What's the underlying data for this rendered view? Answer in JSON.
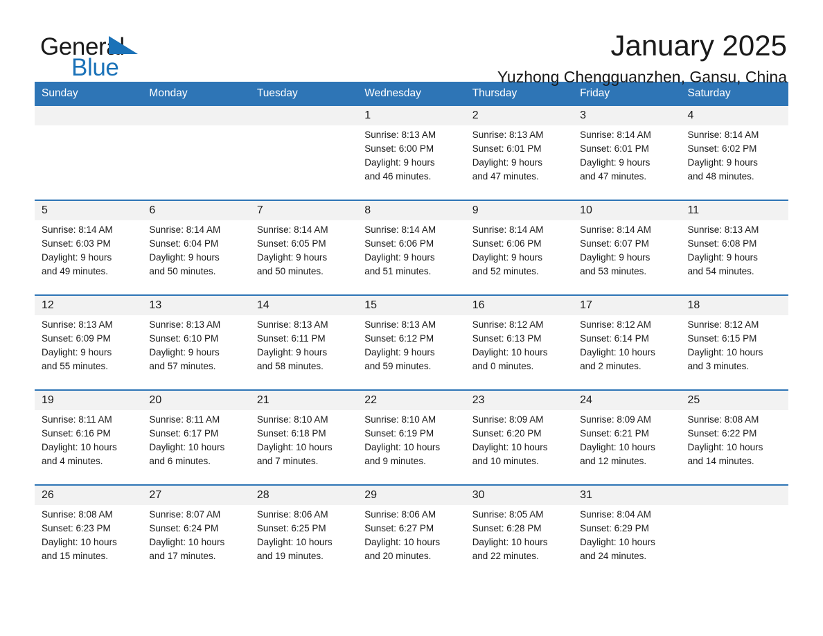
{
  "logo": {
    "word_one": "General",
    "word_two": "Blue",
    "triangle_color": "#1B72B8"
  },
  "header": {
    "month_title": "January 2025",
    "location": "Yuzhong Chengguanzhen, Gansu, China"
  },
  "theme": {
    "header_blue": "#2E75B6",
    "daynum_background": "#f2f2f2",
    "text": "#1a1a1a"
  },
  "calendar": {
    "weekday_headers": [
      "Sunday",
      "Monday",
      "Tuesday",
      "Wednesday",
      "Thursday",
      "Friday",
      "Saturday"
    ],
    "weeks": [
      [
        {
          "day": "",
          "sunrise": "",
          "sunset": "",
          "daylight_1": "",
          "daylight_2": ""
        },
        {
          "day": "",
          "sunrise": "",
          "sunset": "",
          "daylight_1": "",
          "daylight_2": ""
        },
        {
          "day": "",
          "sunrise": "",
          "sunset": "",
          "daylight_1": "",
          "daylight_2": ""
        },
        {
          "day": "1",
          "sunrise": "Sunrise: 8:13 AM",
          "sunset": "Sunset: 6:00 PM",
          "daylight_1": "Daylight: 9 hours",
          "daylight_2": "and 46 minutes."
        },
        {
          "day": "2",
          "sunrise": "Sunrise: 8:13 AM",
          "sunset": "Sunset: 6:01 PM",
          "daylight_1": "Daylight: 9 hours",
          "daylight_2": "and 47 minutes."
        },
        {
          "day": "3",
          "sunrise": "Sunrise: 8:14 AM",
          "sunset": "Sunset: 6:01 PM",
          "daylight_1": "Daylight: 9 hours",
          "daylight_2": "and 47 minutes."
        },
        {
          "day": "4",
          "sunrise": "Sunrise: 8:14 AM",
          "sunset": "Sunset: 6:02 PM",
          "daylight_1": "Daylight: 9 hours",
          "daylight_2": "and 48 minutes."
        }
      ],
      [
        {
          "day": "5",
          "sunrise": "Sunrise: 8:14 AM",
          "sunset": "Sunset: 6:03 PM",
          "daylight_1": "Daylight: 9 hours",
          "daylight_2": "and 49 minutes."
        },
        {
          "day": "6",
          "sunrise": "Sunrise: 8:14 AM",
          "sunset": "Sunset: 6:04 PM",
          "daylight_1": "Daylight: 9 hours",
          "daylight_2": "and 50 minutes."
        },
        {
          "day": "7",
          "sunrise": "Sunrise: 8:14 AM",
          "sunset": "Sunset: 6:05 PM",
          "daylight_1": "Daylight: 9 hours",
          "daylight_2": "and 50 minutes."
        },
        {
          "day": "8",
          "sunrise": "Sunrise: 8:14 AM",
          "sunset": "Sunset: 6:06 PM",
          "daylight_1": "Daylight: 9 hours",
          "daylight_2": "and 51 minutes."
        },
        {
          "day": "9",
          "sunrise": "Sunrise: 8:14 AM",
          "sunset": "Sunset: 6:06 PM",
          "daylight_1": "Daylight: 9 hours",
          "daylight_2": "and 52 minutes."
        },
        {
          "day": "10",
          "sunrise": "Sunrise: 8:14 AM",
          "sunset": "Sunset: 6:07 PM",
          "daylight_1": "Daylight: 9 hours",
          "daylight_2": "and 53 minutes."
        },
        {
          "day": "11",
          "sunrise": "Sunrise: 8:13 AM",
          "sunset": "Sunset: 6:08 PM",
          "daylight_1": "Daylight: 9 hours",
          "daylight_2": "and 54 minutes."
        }
      ],
      [
        {
          "day": "12",
          "sunrise": "Sunrise: 8:13 AM",
          "sunset": "Sunset: 6:09 PM",
          "daylight_1": "Daylight: 9 hours",
          "daylight_2": "and 55 minutes."
        },
        {
          "day": "13",
          "sunrise": "Sunrise: 8:13 AM",
          "sunset": "Sunset: 6:10 PM",
          "daylight_1": "Daylight: 9 hours",
          "daylight_2": "and 57 minutes."
        },
        {
          "day": "14",
          "sunrise": "Sunrise: 8:13 AM",
          "sunset": "Sunset: 6:11 PM",
          "daylight_1": "Daylight: 9 hours",
          "daylight_2": "and 58 minutes."
        },
        {
          "day": "15",
          "sunrise": "Sunrise: 8:13 AM",
          "sunset": "Sunset: 6:12 PM",
          "daylight_1": "Daylight: 9 hours",
          "daylight_2": "and 59 minutes."
        },
        {
          "day": "16",
          "sunrise": "Sunrise: 8:12 AM",
          "sunset": "Sunset: 6:13 PM",
          "daylight_1": "Daylight: 10 hours",
          "daylight_2": "and 0 minutes."
        },
        {
          "day": "17",
          "sunrise": "Sunrise: 8:12 AM",
          "sunset": "Sunset: 6:14 PM",
          "daylight_1": "Daylight: 10 hours",
          "daylight_2": "and 2 minutes."
        },
        {
          "day": "18",
          "sunrise": "Sunrise: 8:12 AM",
          "sunset": "Sunset: 6:15 PM",
          "daylight_1": "Daylight: 10 hours",
          "daylight_2": "and 3 minutes."
        }
      ],
      [
        {
          "day": "19",
          "sunrise": "Sunrise: 8:11 AM",
          "sunset": "Sunset: 6:16 PM",
          "daylight_1": "Daylight: 10 hours",
          "daylight_2": "and 4 minutes."
        },
        {
          "day": "20",
          "sunrise": "Sunrise: 8:11 AM",
          "sunset": "Sunset: 6:17 PM",
          "daylight_1": "Daylight: 10 hours",
          "daylight_2": "and 6 minutes."
        },
        {
          "day": "21",
          "sunrise": "Sunrise: 8:10 AM",
          "sunset": "Sunset: 6:18 PM",
          "daylight_1": "Daylight: 10 hours",
          "daylight_2": "and 7 minutes."
        },
        {
          "day": "22",
          "sunrise": "Sunrise: 8:10 AM",
          "sunset": "Sunset: 6:19 PM",
          "daylight_1": "Daylight: 10 hours",
          "daylight_2": "and 9 minutes."
        },
        {
          "day": "23",
          "sunrise": "Sunrise: 8:09 AM",
          "sunset": "Sunset: 6:20 PM",
          "daylight_1": "Daylight: 10 hours",
          "daylight_2": "and 10 minutes."
        },
        {
          "day": "24",
          "sunrise": "Sunrise: 8:09 AM",
          "sunset": "Sunset: 6:21 PM",
          "daylight_1": "Daylight: 10 hours",
          "daylight_2": "and 12 minutes."
        },
        {
          "day": "25",
          "sunrise": "Sunrise: 8:08 AM",
          "sunset": "Sunset: 6:22 PM",
          "daylight_1": "Daylight: 10 hours",
          "daylight_2": "and 14 minutes."
        }
      ],
      [
        {
          "day": "26",
          "sunrise": "Sunrise: 8:08 AM",
          "sunset": "Sunset: 6:23 PM",
          "daylight_1": "Daylight: 10 hours",
          "daylight_2": "and 15 minutes."
        },
        {
          "day": "27",
          "sunrise": "Sunrise: 8:07 AM",
          "sunset": "Sunset: 6:24 PM",
          "daylight_1": "Daylight: 10 hours",
          "daylight_2": "and 17 minutes."
        },
        {
          "day": "28",
          "sunrise": "Sunrise: 8:06 AM",
          "sunset": "Sunset: 6:25 PM",
          "daylight_1": "Daylight: 10 hours",
          "daylight_2": "and 19 minutes."
        },
        {
          "day": "29",
          "sunrise": "Sunrise: 8:06 AM",
          "sunset": "Sunset: 6:27 PM",
          "daylight_1": "Daylight: 10 hours",
          "daylight_2": "and 20 minutes."
        },
        {
          "day": "30",
          "sunrise": "Sunrise: 8:05 AM",
          "sunset": "Sunset: 6:28 PM",
          "daylight_1": "Daylight: 10 hours",
          "daylight_2": "and 22 minutes."
        },
        {
          "day": "31",
          "sunrise": "Sunrise: 8:04 AM",
          "sunset": "Sunset: 6:29 PM",
          "daylight_1": "Daylight: 10 hours",
          "daylight_2": "and 24 minutes."
        },
        {
          "day": "",
          "sunrise": "",
          "sunset": "",
          "daylight_1": "",
          "daylight_2": ""
        }
      ]
    ]
  }
}
